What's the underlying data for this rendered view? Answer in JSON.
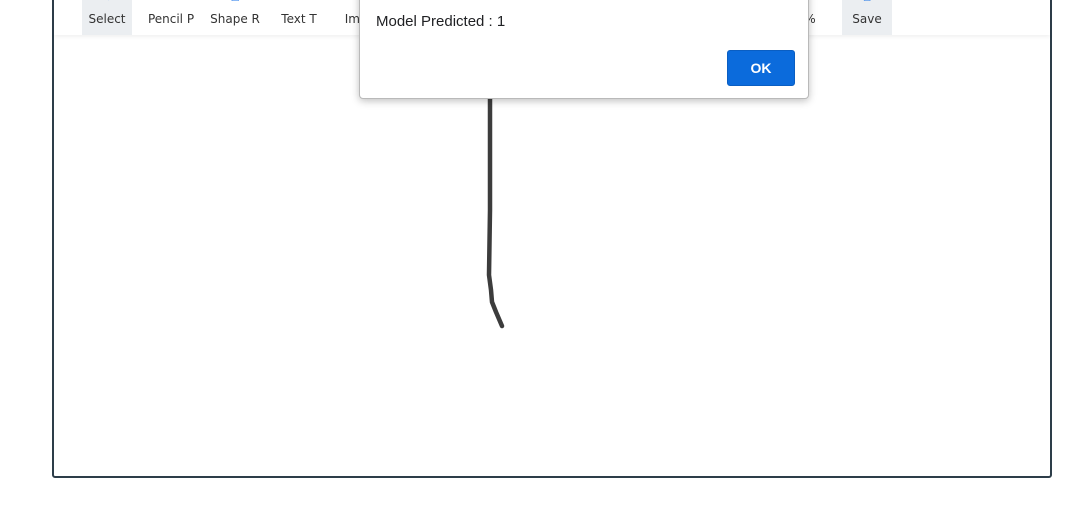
{
  "toolbar": {
    "tools": [
      {
        "label": "Select",
        "icon": "select-cursor-icon"
      },
      {
        "label": "Pencil P",
        "icon": "pencil-icon"
      },
      {
        "label": "Shape R",
        "icon": "shape-icon"
      },
      {
        "label": "Text T",
        "icon": "text-icon"
      },
      {
        "label": "Ima",
        "icon": "image-icon"
      },
      {
        "label": "%",
        "icon": "zoom-icon"
      },
      {
        "label": "Save",
        "icon": "save-icon"
      }
    ]
  },
  "dialog": {
    "message": "Model Predicted : 1",
    "ok_label": "OK"
  },
  "colors": {
    "accent": "#0b6bdc",
    "frame_border": "#2d3d49",
    "stroke": "#3c3c3c"
  }
}
